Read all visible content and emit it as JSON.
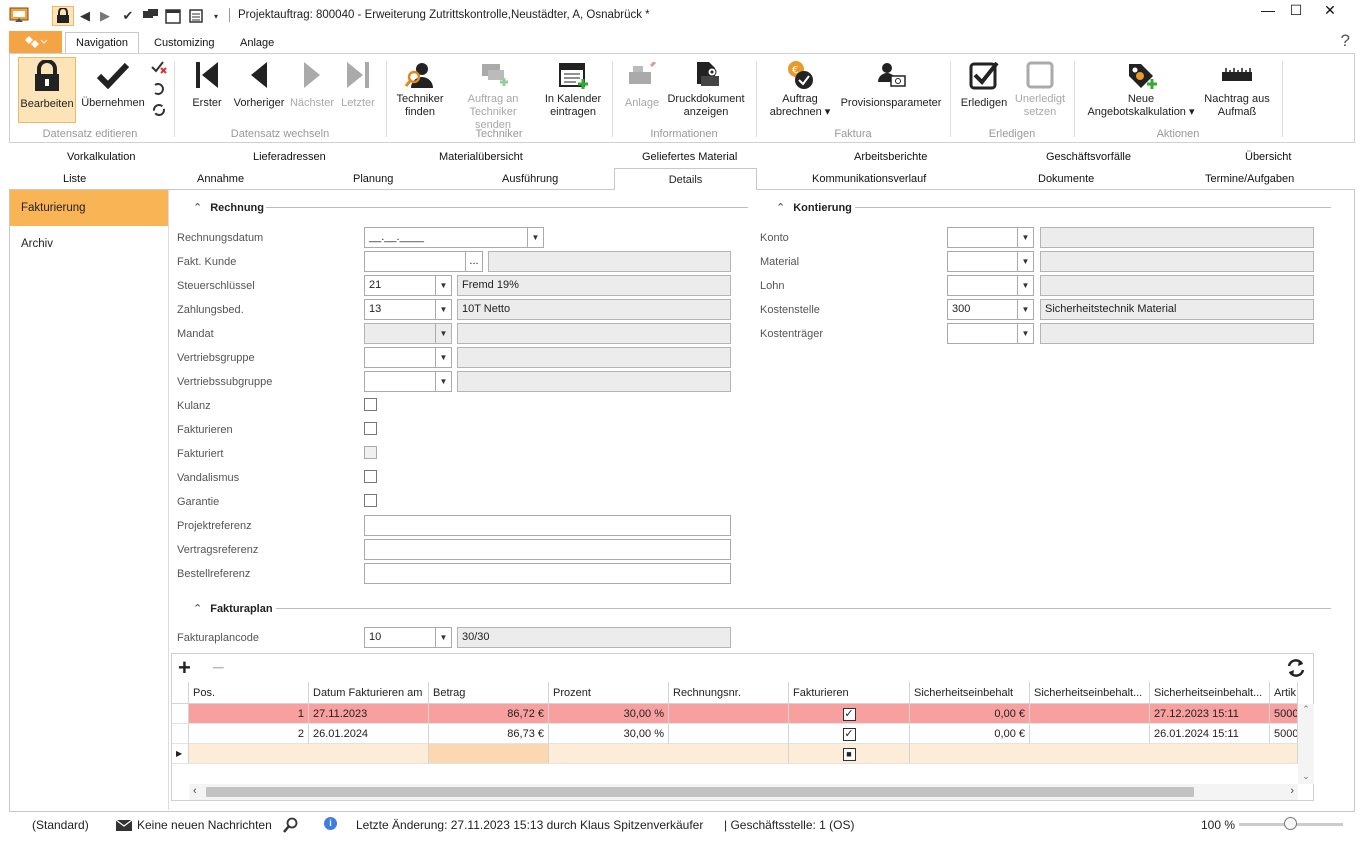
{
  "window": {
    "title": "Projektauftrag: 800040 - Erweiterung Zutrittskontrolle,Neustädter, A, Osnabrück *",
    "minimize": "—",
    "maximize": "☐",
    "close": "✕"
  },
  "ribbon_tabs": [
    "Navigation",
    "Customizing",
    "Anlage"
  ],
  "ribbon": {
    "groups": [
      {
        "label": "Datensatz editieren"
      },
      {
        "label": "Datensatz wechseln"
      },
      {
        "label": "Techniker"
      },
      {
        "label": "Informationen"
      },
      {
        "label": "Faktura"
      },
      {
        "label": "Erledigen"
      },
      {
        "label": "Aktionen"
      }
    ],
    "buttons": {
      "bearbeiten": "Bearbeiten",
      "uebernehmen": "Übernehmen",
      "erster": "Erster",
      "vorheriger": "Vorheriger",
      "naechster": "Nächster",
      "letzter": "Letzter",
      "techniker_finden_1": "Techniker",
      "techniker_finden_2": "finden",
      "auftrag_senden_1": "Auftrag an",
      "auftrag_senden_2": "Techniker senden",
      "kalender_1": "In Kalender",
      "kalender_2": "eintragen",
      "anlage": "Anlage",
      "druck_1": "Druckdokument",
      "druck_2": "anzeigen",
      "abrechnen_1": "Auftrag",
      "abrechnen_2": "abrechnen ▾",
      "provision": "Provisionsparameter",
      "erledigen": "Erledigen",
      "unerledigt_1": "Unerledigt",
      "unerledigt_2": "setzen",
      "neue_kalk_1": "Neue",
      "neue_kalk_2": "Angebotskalkulation ▾",
      "nachtrag_1": "Nachtrag aus",
      "nachtrag_2": "Aufmaß"
    }
  },
  "tabs_row1": [
    "Vorkalkulation",
    "Lieferadressen",
    "Materialübersicht",
    "Geliefertes Material",
    "Arbeitsberichte",
    "Geschäftsvorfälle",
    "Übersicht"
  ],
  "tabs_row2": [
    "Liste",
    "Annahme",
    "Planung",
    "Ausführung",
    "Details",
    "Kommunikationsverlauf",
    "Dokumente",
    "Termine/Aufgaben"
  ],
  "leftnav": [
    "Fakturierung",
    "Archiv"
  ],
  "rechnung": {
    "title": "Rechnung",
    "rechnungsdatum_label": "Rechnungsdatum",
    "rechnungsdatum_value": "__.__.____",
    "fakt_kunde_label": "Fakt. Kunde",
    "fakt_kunde_button": "...",
    "steuerschluessel_label": "Steuerschlüssel",
    "steuerschluessel_code": "21",
    "steuerschluessel_text": "Fremd 19%",
    "zahlungsbed_label": "Zahlungsbed.",
    "zahlungsbed_code": "13",
    "zahlungsbed_text": "10T Netto",
    "mandat_label": "Mandat",
    "vertriebsgruppe_label": "Vertriebsgruppe",
    "vertriebssubgruppe_label": "Vertriebssubgruppe",
    "kulanz_label": "Kulanz",
    "fakturieren_label": "Fakturieren",
    "fakturiert_label": "Fakturiert",
    "vandalismus_label": "Vandalismus",
    "garantie_label": "Garantie",
    "projektreferenz_label": "Projektreferenz",
    "vertragsreferenz_label": "Vertragsreferenz",
    "bestellreferenz_label": "Bestellreferenz"
  },
  "kontierung": {
    "title": "Kontierung",
    "konto_label": "Konto",
    "material_label": "Material",
    "lohn_label": "Lohn",
    "kostenstelle_label": "Kostenstelle",
    "kostenstelle_code": "300",
    "kostenstelle_text": "Sicherheitstechnik Material",
    "kostentraeger_label": "Kostenträger"
  },
  "fakturaplan": {
    "title": "Fakturaplan",
    "code_label": "Fakturaplancode",
    "code_value": "10",
    "code_text": "30/30",
    "columns": [
      "Pos.",
      "Datum Fakturieren am",
      "Betrag",
      "Prozent",
      "Rechnungsnr.",
      "Fakturieren",
      "Sicherheitseinbehalt",
      "Sicherheitseinbehalt...",
      "Sicherheitseinbehalt...",
      "Artik"
    ],
    "rows": [
      {
        "pos": "1",
        "datum": "27.11.2023",
        "betrag": "86,72 €",
        "prozent": "30,00 %",
        "rechnungsnr": "",
        "fakturieren": "✓",
        "sicherheit": "0,00 €",
        "sicherheit2": "",
        "sicherheit3": "27.12.2023 15:11",
        "artikel": "5000"
      },
      {
        "pos": "2",
        "datum": "26.01.2024",
        "betrag": "86,73 €",
        "prozent": "30,00 %",
        "rechnungsnr": "",
        "fakturieren": "✓",
        "sicherheit": "0,00 €",
        "sicherheit2": "",
        "sicherheit3": "26.01.2024 15:11",
        "artikel": "5000"
      }
    ],
    "new_row_marker": "■"
  },
  "statusbar": {
    "layout": "(Standard)",
    "messages": "Keine neuen Nachrichten",
    "last_change": "Letzte Änderung: 27.11.2023 15:13 durch Klaus Spitzenverkäufer",
    "branch": "| Geschäftsstelle:  1 (OS)",
    "zoom": "100 %",
    "zoom_level": 0.5
  },
  "colors": {
    "accent": "#f8b455",
    "row_highlight": "#f8a0a0",
    "new_row": "#fdecd8"
  }
}
